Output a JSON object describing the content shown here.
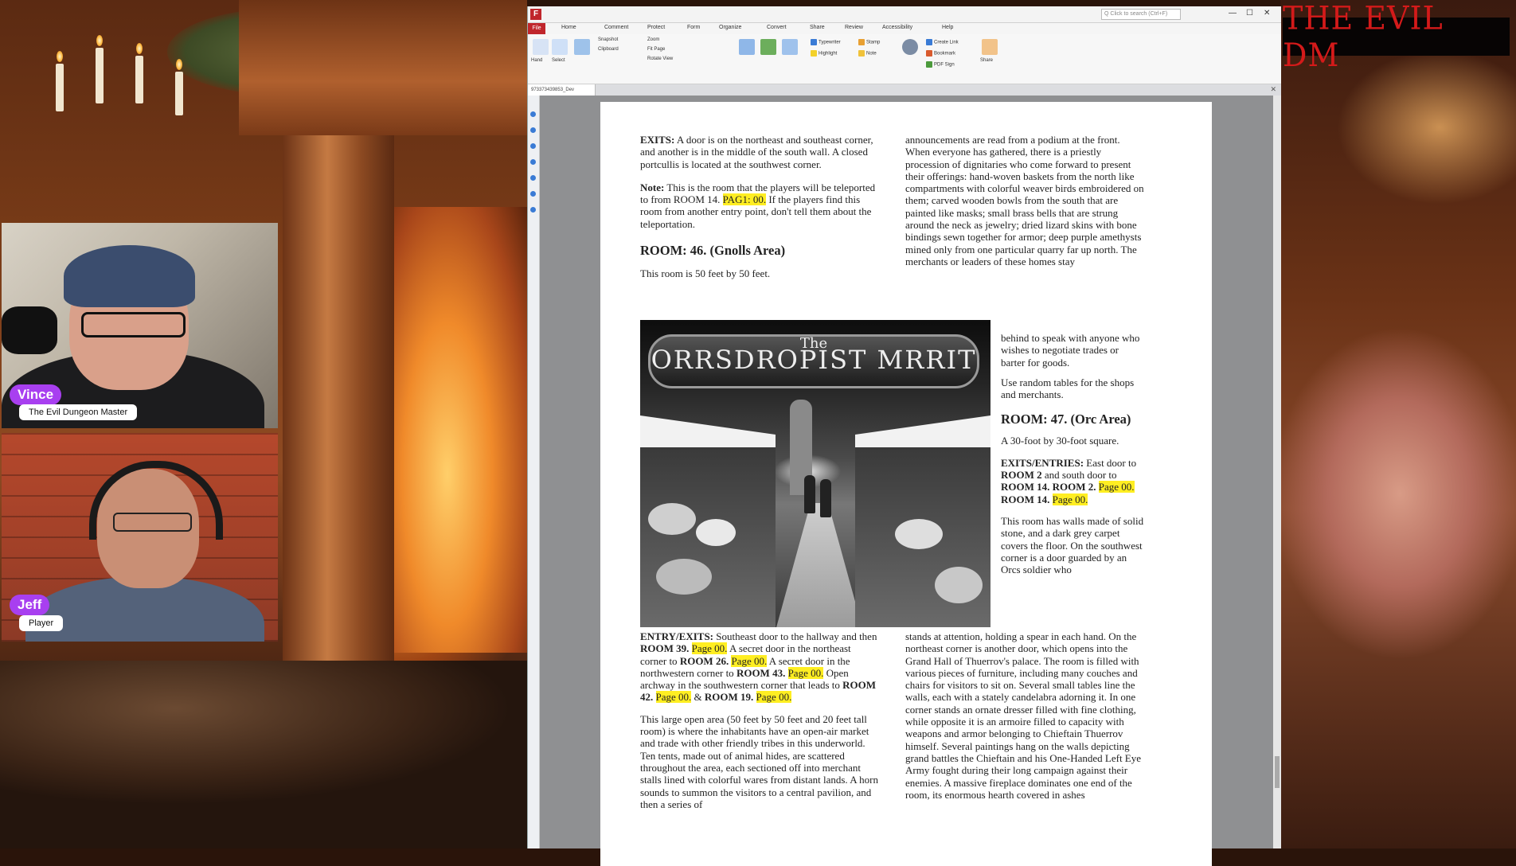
{
  "stream": {
    "banner_title": "THE EVIL DM",
    "cams": [
      {
        "name": "Vince",
        "role": "The Evil Dungeon Master"
      },
      {
        "name": "Jeff",
        "role": "Player"
      }
    ]
  },
  "app": {
    "logo": "F",
    "search_placeholder": "Q Click to search (Ctrl+F)",
    "menus": [
      "File",
      "Home",
      "Comment",
      "Protect",
      "Form",
      "Organize",
      "Convert",
      "Share",
      "Review",
      "Accessibility",
      "Help"
    ],
    "ribbon_items": [
      "Hand",
      "Select",
      "Snapshot",
      "Clipboard",
      "Zoom",
      "Fit Page",
      "Rotate View",
      "Typewriter",
      "Highlight",
      "Stamp",
      "Note",
      "Create Link",
      "Bookmark",
      "PDF Sign",
      "Share"
    ],
    "doc_tab": "973373439853_Dev",
    "window_buttons": [
      "—",
      "☐",
      "✕"
    ]
  },
  "pdf": {
    "left": {
      "exits_label": "EXITS:",
      "exits_text": " A door is on the northeast and southeast corner, and another is in the middle of the south wall. A closed portcullis is located at the southwest corner.",
      "note_label": "Note:",
      "note_text_a": " This is the room that the players will be teleported to from ROOM 14. ",
      "note_hl": "PAG1: 00.",
      "note_text_b": " If the players find this room from another entry point, don't tell them about the teleportation.",
      "room46_heading": "ROOM: 46. (Gnolls Area)",
      "room46_size": "This room is 50 feet by 50 feet.",
      "entry_label": "ENTRY/EXITS:",
      "entry_t1": " Southeast door to the hallway and then ",
      "entry_r39": "ROOM 39.",
      "entry_hl1": "Page 00.",
      "entry_t2": " A secret door in the northeast corner to ",
      "entry_r26": "ROOM 26.",
      "entry_hl2": "Page 00.",
      "entry_t3": " A secret door in the northwestern corner to ",
      "entry_r43": "ROOM 43.",
      "entry_hl3": "Page 00.",
      "entry_t4": " Open archway in the southwestern corner that leads to ",
      "entry_r42": "ROOM 42.",
      "entry_hl4": "Page 00.",
      "entry_t5": " & ",
      "entry_r19": "ROOM 19.",
      "entry_hl5": "Page 00.",
      "large_area": "This large open area (50 feet by 50 feet and 20 feet tall room) is where the inhabitants have an open-air market and trade with other friendly tribes in this underworld. Ten tents, made out of animal hides, are scattered throughout the area, each sectioned off into merchant stalls lined with colorful wares from distant lands. A horn sounds to summon the visitors to a central pavilion, and then a series of"
    },
    "image": {
      "sign_small": "The",
      "sign_text": "ORRSDROPIST MRRIT"
    },
    "right_top": "announcements are read from a podium at the front. When everyone has gathered, there is a priestly procession of dignitaries who come forward to present their offerings: hand-woven baskets from the north like compartments with colorful weaver birds embroidered on them; carved wooden bowls from the south that are painted like masks; small brass bells that are strung around the neck as jewelry; dried lizard skins with bone bindings sewn together for armor; deep purple amethysts mined only from one particular quarry far up north. The merchants or leaders of these homes stay",
    "right_narrow": {
      "behind": "behind to speak with anyone who wishes to negotiate trades or barter for goods.",
      "random": "Use random tables for the shops and merchants.",
      "room47_heading": "ROOM: 47. (Orc Area)",
      "room47_size": "A 30-foot by 30-foot square.",
      "exits_label": "EXITS/ENTRIES:",
      "exits_t1": " East door to ",
      "exits_r2": "ROOM 2",
      "exits_t2": " and south door to ",
      "exits_r14": "ROOM 14.",
      "exits_r2b": "ROOM 2.",
      "exits_hl1": "Page 00.",
      "exits_r14b": "ROOM 14.",
      "exits_hl2": "Page 00.",
      "walls": "This room has walls made of solid stone, and a dark grey carpet covers the floor. On the southwest corner is a door guarded by an Orcs soldier who"
    },
    "right_bottom": "stands at attention, holding a spear in each hand. On the northeast corner is another door, which opens into the Grand Hall of Thuerrov's palace. The room is filled with various pieces of furniture, including many couches and chairs for visitors to sit on. Several small tables line the walls, each with a stately candelabra adorning it. In one corner stands an ornate dresser filled with fine clothing, while opposite it is an armoire filled to capacity with weapons and armor belonging to Chieftain Thuerrov himself. Several paintings hang on the walls depicting grand battles the Chieftain and his One-Handed Left Eye Army fought during their long campaign against their enemies. A massive fireplace dominates one end of the room, its enormous hearth covered in ashes"
  }
}
